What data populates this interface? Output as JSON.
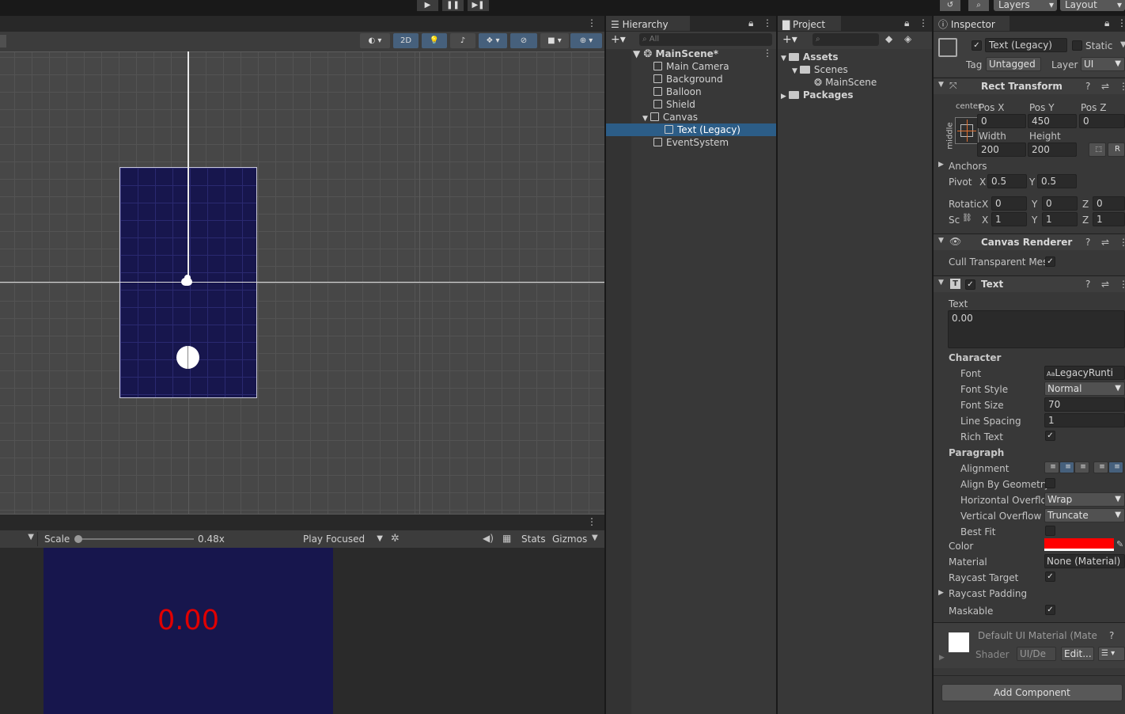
{
  "toolbar": {
    "layers": "Layers",
    "layout": "Layout"
  },
  "scene": {
    "btn_2d": "2D"
  },
  "game": {
    "scale_label": "Scale",
    "scale_value": "0.48x",
    "play_focused": "Play Focused",
    "stats": "Stats",
    "gizmos": "Gizmos",
    "display_text": "0.00"
  },
  "hierarchy": {
    "tab": "Hierarchy",
    "search_placeholder": "All",
    "scene": "MainScene*",
    "items": [
      "Main Camera",
      "Background",
      "Balloon",
      "Shield",
      "Canvas",
      "Text (Legacy)",
      "EventSystem"
    ]
  },
  "project": {
    "tab": "Project",
    "assets": "Assets",
    "scenes": "Scenes",
    "mainscene": "MainScene",
    "packages": "Packages"
  },
  "inspector": {
    "tab": "Inspector",
    "name": "Text (Legacy)",
    "static": "Static",
    "tag_label": "Tag",
    "tag": "Untagged",
    "layer_label": "Layer",
    "layer": "UI",
    "rect": {
      "title": "Rect Transform",
      "anchor_h": "center",
      "anchor_v": "middle",
      "posx_label": "Pos X",
      "posy_label": "Pos Y",
      "posz_label": "Pos Z",
      "posx": "0",
      "posy": "450",
      "posz": "0",
      "width_label": "Width",
      "height_label": "Height",
      "width": "200",
      "height": "200",
      "r_btn": "R",
      "anchors": "Anchors",
      "pivot": "Pivot",
      "pivot_x": "0.5",
      "pivot_y": "0.5",
      "rotation": "Rotatic",
      "rot_x": "0",
      "rot_y": "0",
      "rot_z": "0",
      "scale": "Sc",
      "scale_x": "1",
      "scale_y": "1",
      "scale_z": "1",
      "x": "X",
      "y": "Y",
      "z": "Z"
    },
    "canvas_renderer": {
      "title": "Canvas Renderer",
      "cull": "Cull Transparent Mes"
    },
    "text": {
      "title": "Text",
      "text_label": "Text",
      "text_value": "0.00",
      "character": "Character",
      "font_label": "Font",
      "font": "LegacyRunti",
      "font_style_label": "Font Style",
      "font_style": "Normal",
      "font_size_label": "Font Size",
      "font_size": "70",
      "line_spacing_label": "Line Spacing",
      "line_spacing": "1",
      "rich_text_label": "Rich Text",
      "paragraph": "Paragraph",
      "alignment_label": "Alignment",
      "align_geom_label": "Align By Geometry",
      "hover_label": "Horizontal Overflo",
      "hover": "Wrap",
      "vover_label": "Vertical Overflow",
      "vover": "Truncate",
      "best_fit_label": "Best Fit",
      "color_label": "Color",
      "color": "#ff0000",
      "material_label": "Material",
      "material": "None (Material)",
      "raycast_label": "Raycast Target",
      "raycast_padding": "Raycast Padding",
      "maskable": "Maskable"
    },
    "material": {
      "name": "Default UI Material (Mate",
      "shader_label": "Shader",
      "shader": "UI/De",
      "edit": "Edit..."
    },
    "add_component": "Add Component"
  }
}
